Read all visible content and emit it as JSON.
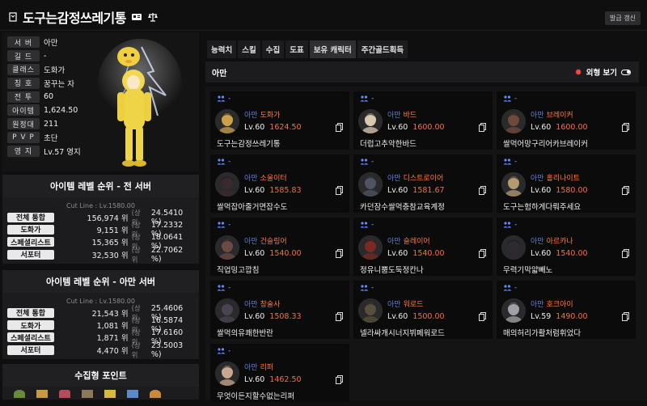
{
  "header": {
    "title": "도구는감정쓰레기통",
    "refresh_label": "발급 갱신"
  },
  "profile": {
    "rows": [
      {
        "key": "서 버",
        "value": "아만"
      },
      {
        "key": "길 드",
        "value": "-"
      },
      {
        "key": "클래스",
        "value": "도화가"
      },
      {
        "key": "칭 호",
        "value": "꿈꾸는 자"
      },
      {
        "key": "전 투",
        "value": "60"
      },
      {
        "key": "아이템",
        "value": "1,624.50"
      },
      {
        "key": "원정대",
        "value": "211"
      },
      {
        "key": "P V P",
        "value": "초단"
      },
      {
        "key": "영 지",
        "value": "Lv.57 영지"
      }
    ]
  },
  "rank_all": {
    "title": "아이템 레벨 순위 - 전 서버",
    "cutline": "Cut Line : Lv.1580.00",
    "sep": "(상위",
    "rows": [
      {
        "label": "전체 통합",
        "rank": "156,974 위",
        "pct": "24.5410 %)"
      },
      {
        "label": "도화가",
        "rank": "9,151 위",
        "pct": "17.2332 %)"
      },
      {
        "label": "스페셜리스트",
        "rank": "15,365 위",
        "pct": "18.0641 %)"
      },
      {
        "label": "서포터",
        "rank": "32,530 위",
        "pct": "22.7062 %)"
      }
    ]
  },
  "rank_server": {
    "title": "아이템 레벨 순위 - 아만 서버",
    "cutline": "Cut Line : Lv.1580.00",
    "sep": "(상위",
    "rows": [
      {
        "label": "전체 통합",
        "rank": "21,543 위",
        "pct": "25.4606 %)"
      },
      {
        "label": "도화가",
        "rank": "1,081 위",
        "pct": "16.5874 %)"
      },
      {
        "label": "스페셜리스트",
        "rank": "1,871 위",
        "pct": "17.6160 %)"
      },
      {
        "label": "서포터",
        "rank": "4,470 위",
        "pct": "23.5003 %)"
      }
    ]
  },
  "collect": {
    "title": "수집형 포인트"
  },
  "tabs": [
    "능력치",
    "스킬",
    "수집",
    "도표",
    "보유 캐릭터",
    "주간골드획득"
  ],
  "active_tab": 4,
  "server_bar": {
    "name": "아만",
    "view_label": "외형 보기"
  },
  "characters": [
    {
      "guild": "-",
      "server": "아만",
      "class": "도화가",
      "level": "Lv.60",
      "ilvl": "1624.50",
      "nick": "도구는감정쓰레기통",
      "avatar": "#caa24a"
    },
    {
      "guild": "-",
      "server": "아만",
      "class": "바드",
      "level": "Lv.60",
      "ilvl": "1600.00",
      "nick": "더럽고추악한바드",
      "avatar": "#d8c8b0"
    },
    {
      "guild": "-",
      "server": "아만",
      "class": "브레이커",
      "level": "Lv.60",
      "ilvl": "1600.00",
      "nick": "쌀먹어망구리어카브레이커",
      "avatar": "#6d4a3a"
    },
    {
      "guild": "-",
      "server": "아만",
      "class": "소울이터",
      "level": "Lv.60",
      "ilvl": "1585.83",
      "nick": "쌀먹잡아줄거면잡수도",
      "avatar": "#3a2a2e"
    },
    {
      "guild": "-",
      "server": "아만",
      "class": "디스트로이어",
      "level": "Lv.60",
      "ilvl": "1581.67",
      "nick": "카던잠수쌀먹충참교육계정",
      "avatar": "#4e5560"
    },
    {
      "guild": "-",
      "server": "아만",
      "class": "홀리나이트",
      "level": "Lv.60",
      "ilvl": "1580.00",
      "nick": "도구는험하게다뤄주세요",
      "avatar": "#b49a70"
    },
    {
      "guild": "-",
      "server": "아만",
      "class": "건슬링어",
      "level": "Lv.60",
      "ilvl": "1540.00",
      "nick": "직업밍고깝침",
      "avatar": "#6b4a42"
    },
    {
      "guild": "-",
      "server": "아만",
      "class": "슬레이어",
      "level": "Lv.60",
      "ilvl": "1540.00",
      "nick": "정유니뿜도둑정칸나",
      "avatar": "#7a2a22"
    },
    {
      "guild": "-",
      "server": "아만",
      "class": "아르카나",
      "level": "Lv.60",
      "ilvl": "1540.00",
      "nick": "무력기막얇빼노",
      "avatar": "#2e2a30"
    },
    {
      "guild": "-",
      "server": "아만",
      "class": "창술사",
      "level": "Lv.60",
      "ilvl": "1508.33",
      "nick": "쌀먹의유쾌한반란",
      "avatar": "#4a4450"
    },
    {
      "guild": "-",
      "server": "아만",
      "class": "워로드",
      "level": "Lv.60",
      "ilvl": "1500.00",
      "nick": "넬라싸개시너지뷔페워로드",
      "avatar": "#58503e"
    },
    {
      "guild": "-",
      "server": "아만",
      "class": "호크아이",
      "level": "Lv.59",
      "ilvl": "1490.00",
      "nick": "매의허리가활처럼휘었다",
      "avatar": "#a0a0a6"
    },
    {
      "guild": "-",
      "server": "아만",
      "class": "리퍼",
      "level": "Lv.60",
      "ilvl": "1462.50",
      "nick": "무엇이든지할수없는리퍼",
      "avatar": "#c8a890"
    }
  ],
  "colors": {
    "accent_blue": "#5f7dd8",
    "ilvl_orange": "#ff6a3d",
    "bg": "#0f0f10"
  }
}
